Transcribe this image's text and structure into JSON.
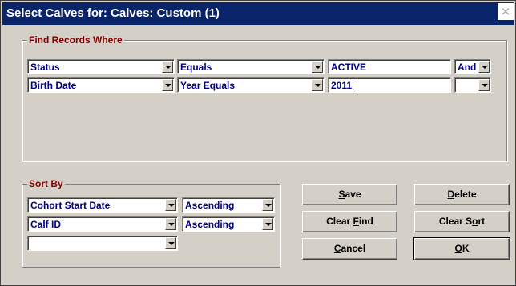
{
  "window": {
    "title": "Select Calves for: Calves: Custom (1)",
    "close_glyph": "×"
  },
  "find": {
    "group_label": "Find Records Where",
    "rows": [
      {
        "field": "Status",
        "operator": "Equals",
        "value": "ACTIVE",
        "conjunction": "And"
      },
      {
        "field": "Birth Date",
        "operator": "Year Equals",
        "value": "2011",
        "conjunction": ""
      }
    ]
  },
  "sort": {
    "group_label": "Sort By",
    "rows": [
      {
        "field": "Cohort Start Date",
        "order": "Ascending"
      },
      {
        "field": "Calf ID",
        "order": "Ascending"
      },
      {
        "field": ""
      }
    ]
  },
  "buttons": {
    "save": {
      "pre": "",
      "key": "S",
      "post": "ave"
    },
    "delete": {
      "pre": "",
      "key": "D",
      "post": "elete"
    },
    "clear_find": {
      "pre": "Clear ",
      "key": "F",
      "post": "ind"
    },
    "clear_sort": {
      "pre": "Clear S",
      "key": "o",
      "post": "rt"
    },
    "cancel": {
      "pre": "",
      "key": "C",
      "post": "ancel"
    },
    "ok": {
      "pre": "",
      "key": "O",
      "post": "K"
    }
  },
  "colors": {
    "titlebar": "#0a246a",
    "group_label": "#800000",
    "field_text": "#000080",
    "face": "#d4d0c8"
  }
}
